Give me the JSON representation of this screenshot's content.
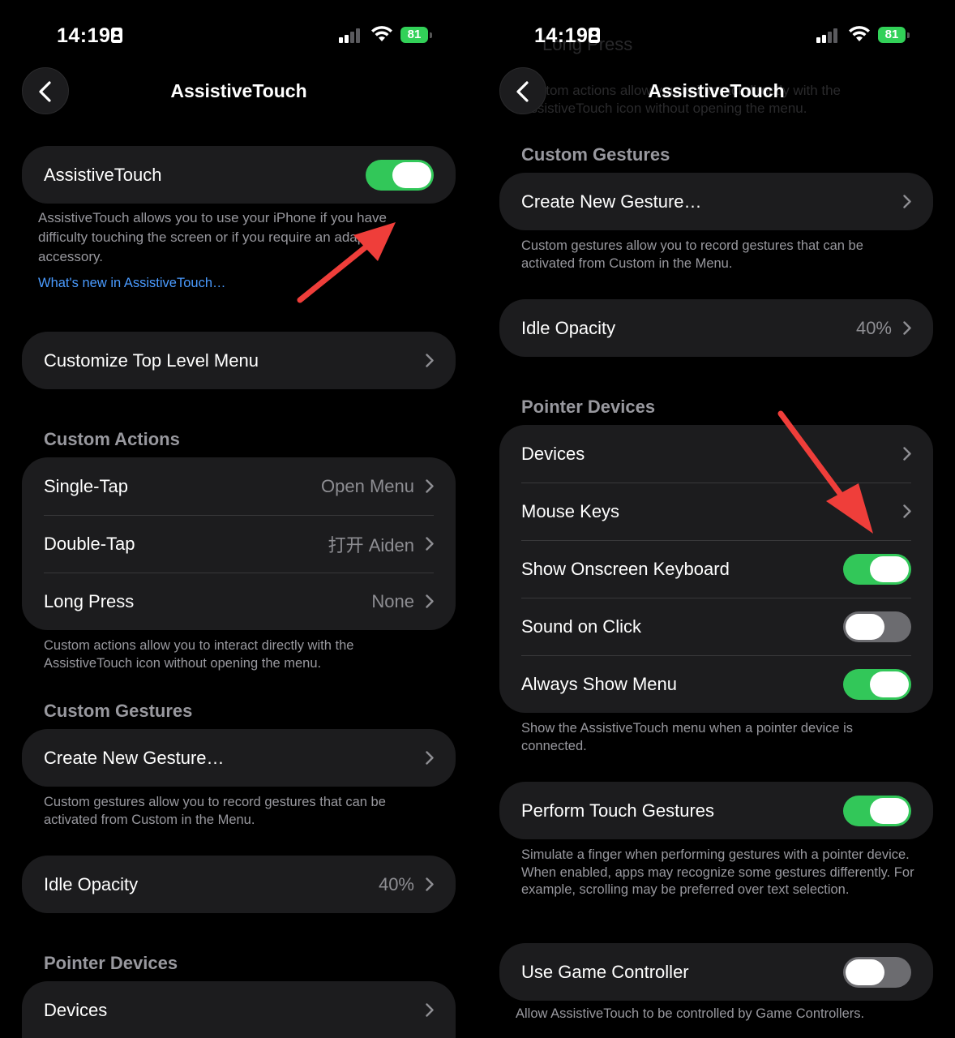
{
  "left": {
    "status": {
      "time": "14:19",
      "battery": "81"
    },
    "nav": {
      "title": "AssistiveTouch"
    },
    "assistive_toggle_label": "AssistiveTouch",
    "assistive_desc": "AssistiveTouch allows you to use your iPhone if you have difficulty touching the screen or if you require an adaptive accessory.",
    "whats_new": "What's new in AssistiveTouch…",
    "customize_menu": "Customize Top Level Menu",
    "custom_actions_header": "Custom Actions",
    "actions": [
      {
        "label": "Single-Tap",
        "value": "Open Menu"
      },
      {
        "label": "Double-Tap",
        "value": "打开 Aiden"
      },
      {
        "label": "Long Press",
        "value": "None"
      }
    ],
    "custom_actions_footer": "Custom actions allow you to interact directly with the AssistiveTouch icon without opening the menu.",
    "custom_gestures_header": "Custom Gestures",
    "create_gesture": "Create New Gesture…",
    "custom_gestures_footer": "Custom gestures allow you to record gestures that can be activated from Custom in the Menu.",
    "idle_opacity": {
      "label": "Idle Opacity",
      "value": "40%"
    },
    "pointer_header": "Pointer Devices",
    "devices": "Devices"
  },
  "right": {
    "status": {
      "time": "14:19",
      "battery": "81"
    },
    "nav": {
      "title": "AssistiveTouch"
    },
    "ghost_title": "Long Press",
    "ghost_text_1": "Custom actions allow you to interact directly with the",
    "ghost_text_2": "AssistiveTouch icon without opening the menu.",
    "custom_gestures_header": "Custom Gestures",
    "create_gesture": "Create New Gesture…",
    "custom_gestures_footer": "Custom gestures allow you to record gestures that can be activated from Custom in the Menu.",
    "idle_opacity": {
      "label": "Idle Opacity",
      "value": "40%"
    },
    "pointer_header": "Pointer Devices",
    "pointer_rows": {
      "devices": "Devices",
      "mouse_keys": "Mouse Keys",
      "onscreen_keyboard": "Show Onscreen Keyboard",
      "sound_on_click": "Sound on Click",
      "always_show_menu": "Always Show Menu"
    },
    "pointer_footer": "Show the AssistiveTouch menu when a pointer device is connected.",
    "perform_touch": "Perform Touch Gestures",
    "perform_touch_footer": "Simulate a finger when performing gestures with a pointer device. When enabled, apps may recognize some gestures differently. For example, scrolling may be preferred over text selection.",
    "game_controller": "Use Game Controller",
    "game_controller_footer": "Allow AssistiveTouch to be controlled by Game Controllers."
  },
  "toggles": {
    "assistive_touch": true,
    "show_onscreen_keyboard": true,
    "sound_on_click": false,
    "always_show_menu": true,
    "perform_touch_gestures": true,
    "use_game_controller": false
  },
  "colors": {
    "toggle_on": "#32c759",
    "annotation_arrow": "#ef3e3a",
    "link": "#4a9bff"
  },
  "icons": [
    "back-chevron-icon",
    "chevron-right-icon",
    "signal-icon",
    "wifi-icon",
    "battery-icon",
    "id-card-icon",
    "annotation-arrow"
  ]
}
